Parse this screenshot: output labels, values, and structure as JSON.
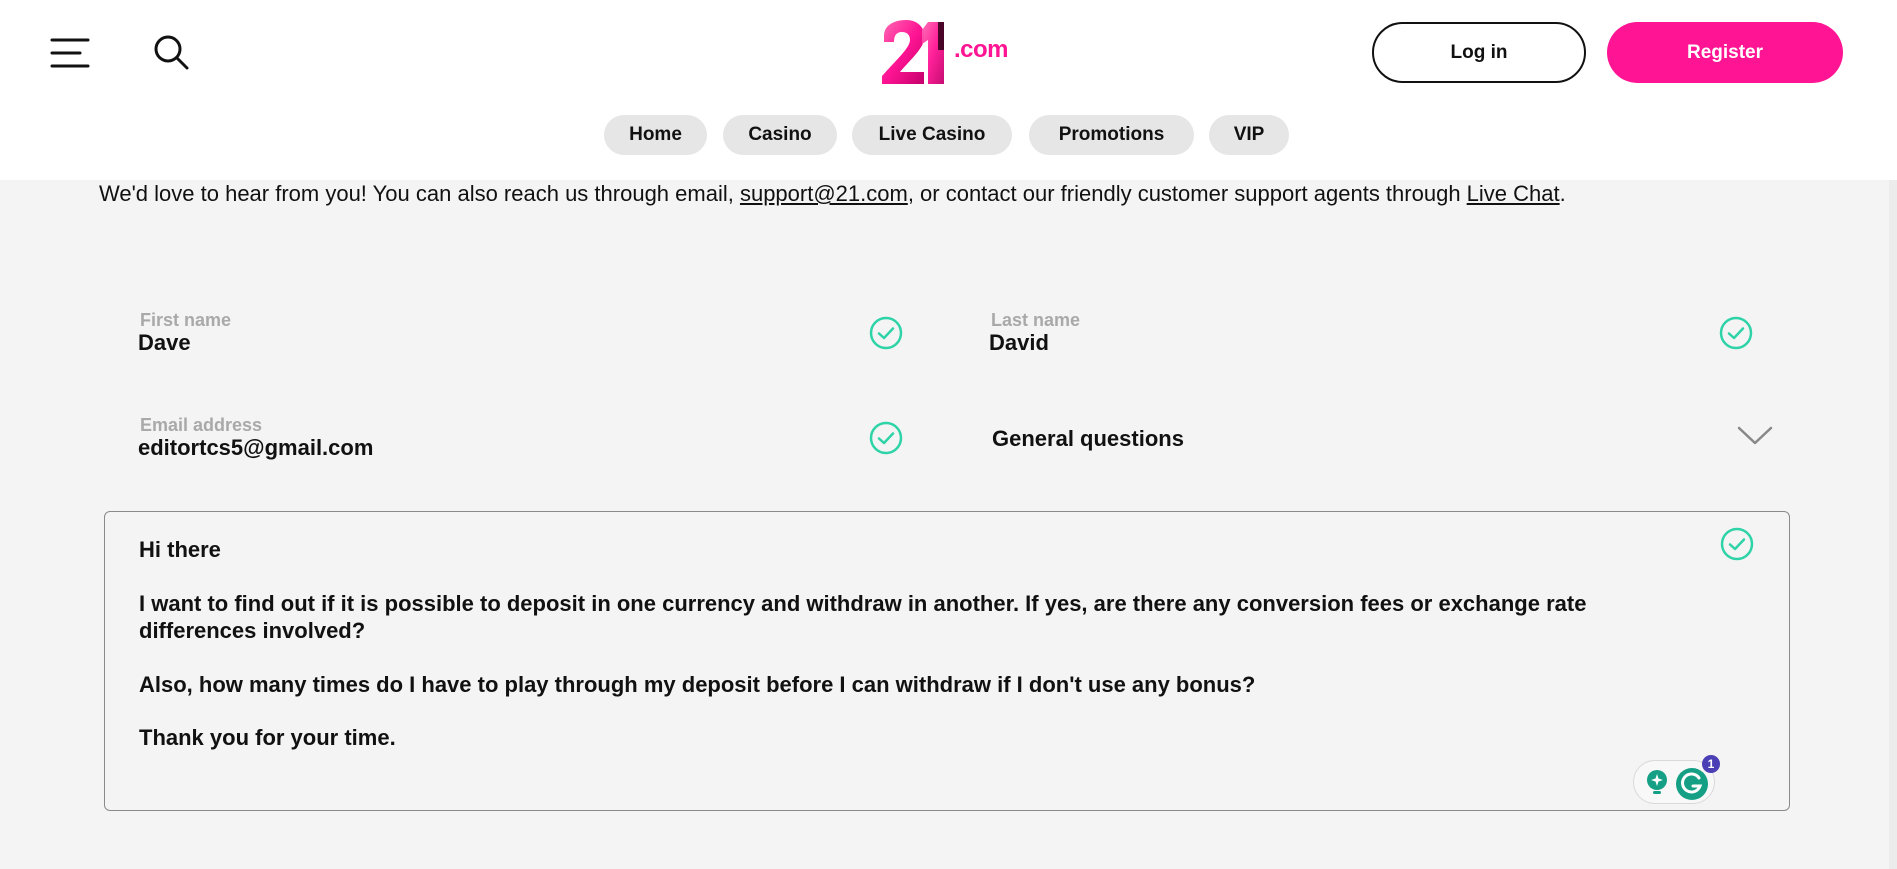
{
  "header": {
    "logo_text": ".com",
    "logo_mark": "21",
    "login_label": "Log in",
    "register_label": "Register",
    "icons": {
      "menu": "hamburger-menu-icon",
      "search": "search-icon"
    }
  },
  "nav": {
    "items": [
      {
        "label": "Home"
      },
      {
        "label": "Casino"
      },
      {
        "label": "Live Casino"
      },
      {
        "label": "Promotions"
      },
      {
        "label": "VIP"
      }
    ]
  },
  "intro": {
    "before": "We'd love to hear from you! You can also reach us through email, ",
    "email_link": "support@21.com",
    "middle": ", or contact our friendly customer support agents through ",
    "chat_link": "Live Chat",
    "after": "."
  },
  "form": {
    "first_name": {
      "label": "First name",
      "value": "Dave"
    },
    "last_name": {
      "label": "Last name",
      "value": "David"
    },
    "email": {
      "label": "Email address",
      "value": "editortcs5@gmail.com"
    },
    "topic": {
      "value": "General questions"
    },
    "message": {
      "line1": "Hi there",
      "line2": "I want to find out if it is possible to deposit in one currency and withdraw in another. If yes, are there any conversion fees or exchange rate",
      "line3": "differences involved?",
      "line4": "Also, how many times do I have to play through my deposit before I can withdraw if I don't use any bonus?",
      "line5": "Thank you for your time."
    },
    "grammarly_badge": "1"
  },
  "colors": {
    "brand": "#ff1493",
    "check": "#2ed3a8",
    "grammarly": "#15a085"
  }
}
